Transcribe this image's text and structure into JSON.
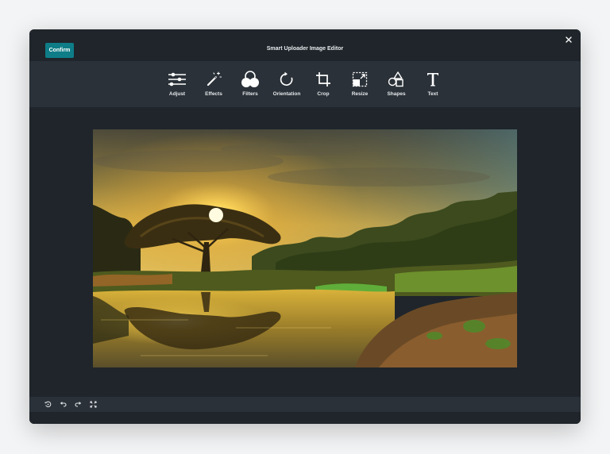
{
  "header": {
    "confirm_label": "Confirm",
    "title": "Smart Uploader Image Editor",
    "close_icon": "close-icon"
  },
  "toolbar": {
    "tools": [
      {
        "label": "Adjust",
        "icon": "sliders-icon"
      },
      {
        "label": "Effects",
        "icon": "magic-wand-icon"
      },
      {
        "label": "Filters",
        "icon": "filters-circles-icon"
      },
      {
        "label": "Orientation",
        "icon": "rotate-icon"
      },
      {
        "label": "Crop",
        "icon": "crop-icon"
      },
      {
        "label": "Resize",
        "icon": "resize-icon"
      },
      {
        "label": "Shapes",
        "icon": "shapes-icon"
      },
      {
        "label": "Text",
        "icon": "text-icon"
      }
    ]
  },
  "bottom_toolbar": {
    "buttons": [
      {
        "icon": "reset-icon"
      },
      {
        "icon": "undo-icon"
      },
      {
        "icon": "redo-icon"
      },
      {
        "icon": "fullscreen-icon"
      }
    ]
  },
  "colors": {
    "accent": "#0e7d87",
    "window_bg": "#1f252b",
    "toolbar_bg": "#2a3138"
  }
}
